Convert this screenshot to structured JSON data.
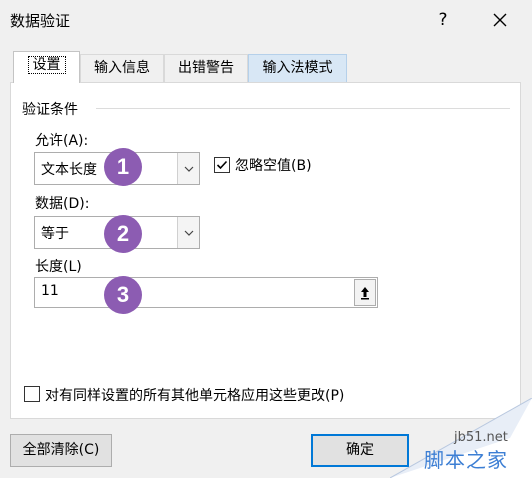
{
  "window": {
    "title": "数据验证",
    "help_label": "?"
  },
  "tabs": [
    {
      "label": "设置",
      "active": true
    },
    {
      "label": "输入信息"
    },
    {
      "label": "出错警告"
    },
    {
      "label": "输入法模式"
    }
  ],
  "settings": {
    "group_title": "验证条件",
    "allow_label": "允许(A):",
    "allow_value": "文本长度",
    "ignore_blank_label": "忽略空值(B)",
    "ignore_blank_checked": true,
    "data_label": "数据(D):",
    "data_value": "等于",
    "length_label": "长度(L)",
    "length_value": "11",
    "apply_all_label": "对有同样设置的所有其他单元格应用这些更改(P)",
    "apply_all_checked": false
  },
  "badges": [
    "1",
    "2",
    "3"
  ],
  "buttons": {
    "clear_all": "全部清除(C)",
    "ok": "确定"
  },
  "watermark": {
    "url": "jb51.net",
    "brand": "脚本之家"
  },
  "colors": {
    "badge": "#8c5cb2",
    "focus": "#0078d7",
    "tab_hover": "#d8e7f5"
  },
  "icons": {
    "help": "question-mark-icon",
    "close": "close-icon",
    "dropdown": "chevron-down-icon",
    "range_picker": "collapse-arrow-icon",
    "check": "checkmark-icon"
  }
}
